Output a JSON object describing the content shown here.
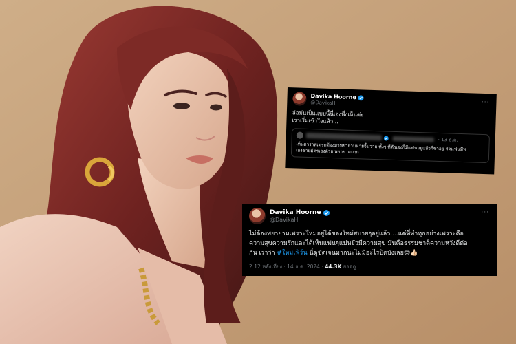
{
  "tweet1": {
    "display_name": "Davika Hoorne",
    "handle": "@DavikaH",
    "text": "ล่อมันเป็นแบบนี้นี่เองพึ่งเห็นค่ะ\nเราเริ่มเข้าใจแล้ว...",
    "quote": {
      "date": "· 13 ธ.ค.",
      "text": "เห็นดาราสเตรทต้องมาพยายามหายจิ้นวาย ทั้งๆ ที่ตัวเองก็มีแฟนอยู่แล้วก็ชาอยู่ จัดแฟนมีท\nเองชายมีตรเองด้วย พยายามมาก"
    }
  },
  "tweet2": {
    "display_name": "Davika Hoorne",
    "handle": "@DavikaH",
    "text_before": "ไม่ต้องพยายามเพราะใหม่อยู่ได้ของใหม่สบายๆอยู่แล้ว....แต่ที่ทำทุกอย่างเพราะคือ\nความสุขความรักและได้เห็นแฟนๆแม่หยัวมีความสุข มันคือธรรมชาติความหวังดีต่อ\nกัน เราว่า ",
    "hashtag": "#ใหม่เฟิร์น",
    "text_after": " นี่ดูชัดเจนมากนะไม่มีอะไรปิดบังเลย😊👍🏻",
    "time": "2:12 หลังเที่ยง · 14 ธ.ค. 2024 · ",
    "views": "44.3K",
    "views_label": " ยอดดู"
  },
  "colors": {
    "background": "#c7a27c",
    "card": "#000000",
    "link": "#1d9bf0",
    "secondary_text": "#71767b"
  }
}
